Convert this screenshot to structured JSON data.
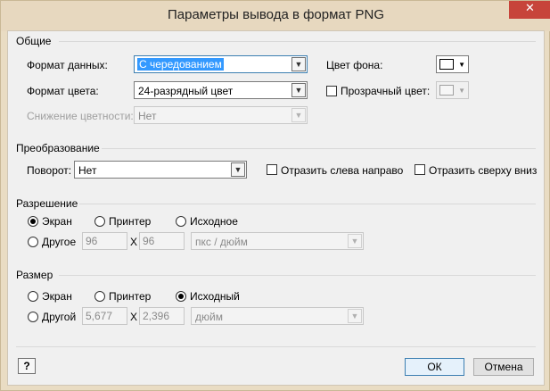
{
  "window": {
    "title": "Параметры вывода в формат PNG",
    "close_glyph": "✕"
  },
  "general": {
    "title": "Общие",
    "data_format_label": "Формат данных:",
    "data_format_value": "С чередованием",
    "color_format_label": "Формат цвета:",
    "color_format_value": "24-разрядный цвет",
    "color_reduction_label": "Снижение цветности:",
    "color_reduction_value": "Нет",
    "bg_color_label": "Цвет фона:",
    "transparent_label": "Прозрачный цвет:"
  },
  "transform": {
    "title": "Преобразование",
    "rotation_label": "Поворот:",
    "rotation_value": "Нет",
    "flip_h_label": "Отразить слева направо",
    "flip_v_label": "Отразить сверху вниз"
  },
  "resolution": {
    "title": "Разрешение",
    "screen_label": "Экран",
    "printer_label": "Принтер",
    "source_label": "Исходное",
    "other_label": "Другое",
    "x_value": "96",
    "y_value": "96",
    "x_sep": "X",
    "unit_value": "пкс / дюйм",
    "selected": "screen"
  },
  "size": {
    "title": "Размер",
    "screen_label": "Экран",
    "printer_label": "Принтер",
    "source_label": "Исходный",
    "other_label": "Другой",
    "w_value": "5,677",
    "h_value": "2,396",
    "x_sep": "X",
    "unit_value": "дюйм",
    "selected": "source"
  },
  "footer": {
    "help_glyph": "?",
    "ok_label": "ОК",
    "cancel_label": "Отмена"
  },
  "icons": {
    "help": "help-icon",
    "dropdown": "chevron-down-icon",
    "close": "close-icon"
  }
}
